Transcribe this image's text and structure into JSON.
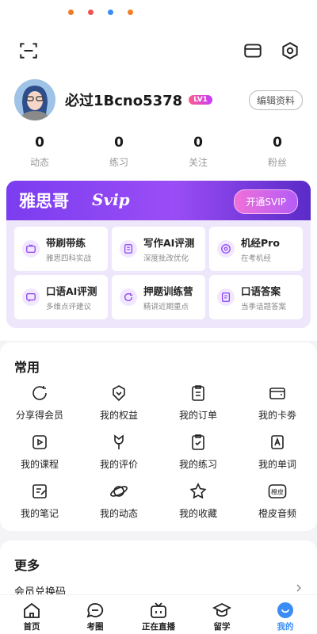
{
  "header": {
    "scan_icon": "scan-icon",
    "message_icon": "message-icon",
    "settings_icon": "settings-icon"
  },
  "profile": {
    "username": "必过1Bcno5378",
    "level": "LV1",
    "edit_label": "编辑资料"
  },
  "stats": [
    {
      "value": "0",
      "label": "动态"
    },
    {
      "value": "0",
      "label": "练习"
    },
    {
      "value": "0",
      "label": "关注"
    },
    {
      "value": "0",
      "label": "粉丝"
    }
  ],
  "svip": {
    "title": "雅思哥",
    "tag": "Svip",
    "open_label": "开通SVIP",
    "items": [
      {
        "title": "带刷带练",
        "subtitle": "雅思四科实战",
        "icon": "tv-icon"
      },
      {
        "title": "写作AI评测",
        "subtitle": "深度批改优化",
        "icon": "ai-write-icon"
      },
      {
        "title": "机经Pro",
        "subtitle": "在考机经",
        "icon": "target-icon"
      },
      {
        "title": "口语AI评测",
        "subtitle": "多维点评建议",
        "icon": "ai-speak-icon"
      },
      {
        "title": "押题训练营",
        "subtitle": "精讲近期重点",
        "icon": "refresh-icon"
      },
      {
        "title": "口语答案",
        "subtitle": "当季话题答案",
        "icon": "doc-icon"
      }
    ]
  },
  "common": {
    "title": "常用",
    "items": [
      {
        "label": "分享得会员",
        "icon": "share-icon"
      },
      {
        "label": "我的权益",
        "icon": "badge-icon"
      },
      {
        "label": "我的订单",
        "icon": "order-icon"
      },
      {
        "label": "我的卡劵",
        "icon": "wallet-icon"
      },
      {
        "label": "我的课程",
        "icon": "course-icon"
      },
      {
        "label": "我的评价",
        "icon": "flower-icon"
      },
      {
        "label": "我的练习",
        "icon": "practice-icon"
      },
      {
        "label": "我的单词",
        "icon": "word-icon"
      },
      {
        "label": "我的笔记",
        "icon": "note-icon"
      },
      {
        "label": "我的动态",
        "icon": "planet-icon"
      },
      {
        "label": "我的收藏",
        "icon": "star-icon"
      },
      {
        "label": "橙皮音频",
        "icon": "audio-icon"
      }
    ],
    "audio_badge": "橙皮"
  },
  "more": {
    "title": "更多",
    "item": "会员兑换码"
  },
  "tabs": [
    {
      "label": "首页",
      "icon": "home-icon"
    },
    {
      "label": "考圈",
      "icon": "chat-icon"
    },
    {
      "label": "正在直播",
      "icon": "live-icon"
    },
    {
      "label": "留学",
      "icon": "graduation-icon"
    },
    {
      "label": "我的",
      "icon": "profile-icon"
    }
  ],
  "colors": {
    "accent": "#3a8df5",
    "svip_purple": "#8a45f2"
  }
}
